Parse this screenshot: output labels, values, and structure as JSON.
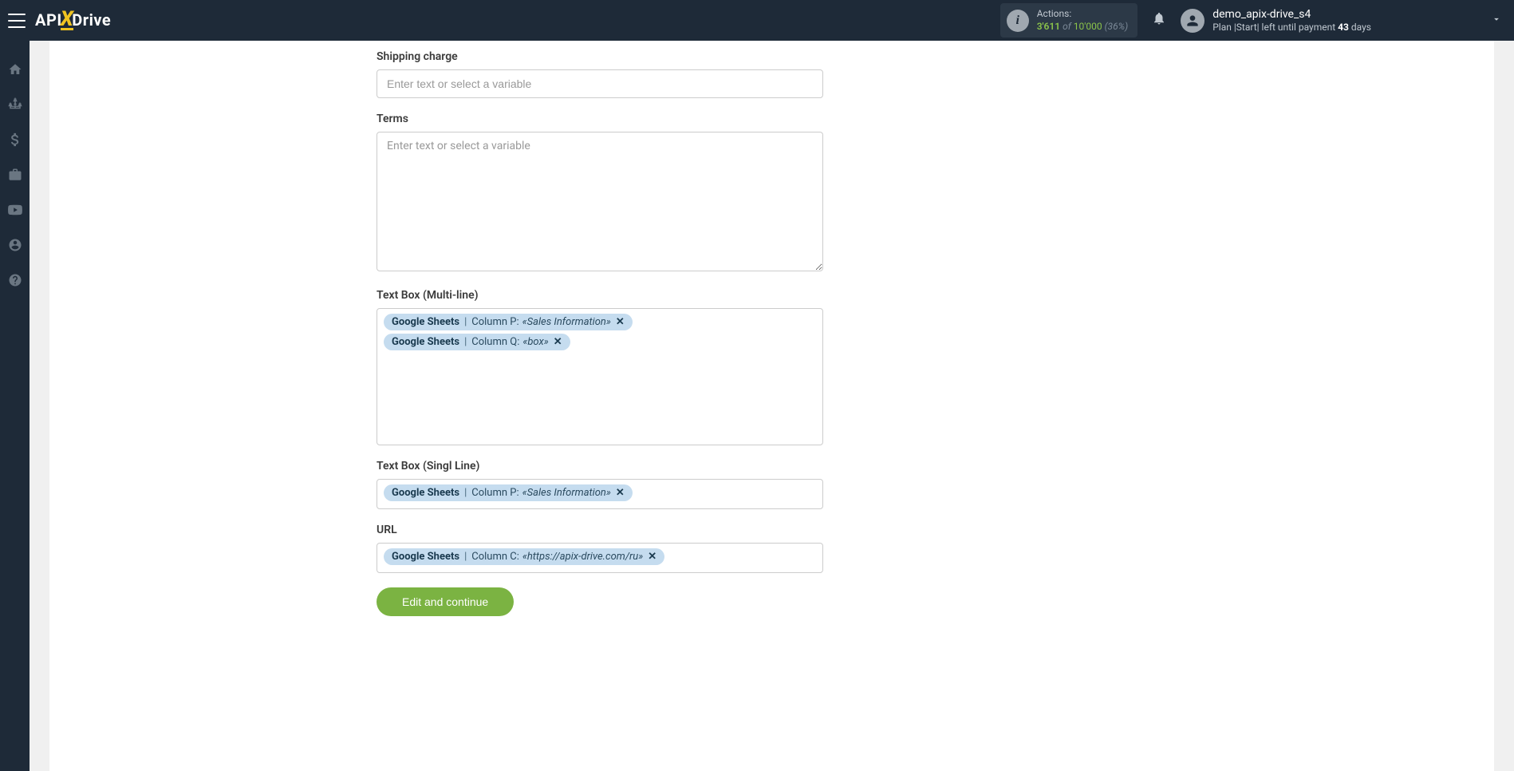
{
  "header": {
    "logo": {
      "pre": "API",
      "x": "X",
      "post": "Drive"
    },
    "actions": {
      "label": "Actions:",
      "current": "3'611",
      "of": "of",
      "total": "10'000",
      "pct": "(36%)"
    },
    "user": {
      "name": "demo_apix-drive_s4",
      "plan_prefix": "Plan |Start| left until payment ",
      "plan_days": "43",
      "plan_suffix": " days"
    }
  },
  "form": {
    "placeholder": "Enter text or select a variable",
    "shipping_charge": {
      "label": "Shipping charge"
    },
    "terms": {
      "label": "Terms"
    },
    "textbox_multi": {
      "label": "Text Box (Multi-line)",
      "tags": [
        {
          "source": "Google Sheets",
          "col": "Column P:",
          "val": "«Sales Information»"
        },
        {
          "source": "Google Sheets",
          "col": "Column Q:",
          "val": "«box»"
        }
      ]
    },
    "textbox_single": {
      "label": "Text Box (Singl Line)",
      "tags": [
        {
          "source": "Google Sheets",
          "col": "Column P:",
          "val": "«Sales Information»"
        }
      ]
    },
    "url": {
      "label": "URL",
      "tags": [
        {
          "source": "Google Sheets",
          "col": "Column C:",
          "val": "«https://apix-drive.com/ru»"
        }
      ]
    },
    "submit": "Edit and continue"
  }
}
